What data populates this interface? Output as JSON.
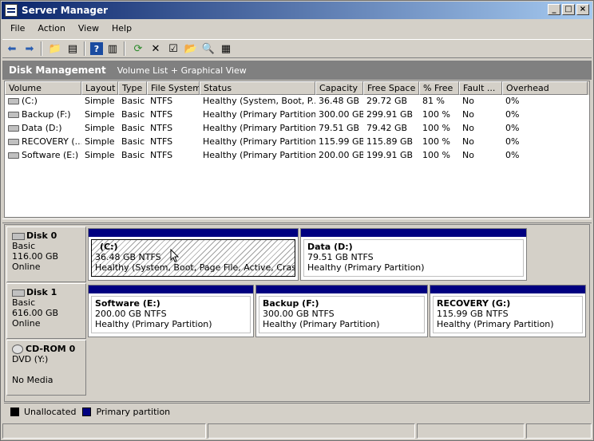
{
  "window": {
    "title": "Server Manager"
  },
  "menu": [
    "File",
    "Action",
    "View",
    "Help"
  ],
  "toolbar": [
    "back-icon",
    "forward-icon",
    "up-folder-icon",
    "show-hide-tree-icon",
    "help-icon",
    "properties-pane-icon",
    "refresh-icon",
    "delete-icon",
    "properties-icon",
    "open-icon",
    "search-icon",
    "export-icon"
  ],
  "header": {
    "title": "Disk Management",
    "view": "Volume List + Graphical View"
  },
  "columns": [
    "Volume",
    "Layout",
    "Type",
    "File System",
    "Status",
    "Capacity",
    "Free Space",
    "% Free",
    "Fault ...",
    "Overhead"
  ],
  "volumes": [
    [
      "(C:)",
      "Simple",
      "Basic",
      "NTFS",
      "Healthy (System, Boot, P...",
      "36.48 GB",
      "29.72 GB",
      "81 %",
      "No",
      "0%"
    ],
    [
      "Backup (F:)",
      "Simple",
      "Basic",
      "NTFS",
      "Healthy (Primary Partition)",
      "300.00 GB",
      "299.91 GB",
      "100 %",
      "No",
      "0%"
    ],
    [
      "Data (D:)",
      "Simple",
      "Basic",
      "NTFS",
      "Healthy (Primary Partition)",
      "79.51 GB",
      "79.42 GB",
      "100 %",
      "No",
      "0%"
    ],
    [
      "RECOVERY (...",
      "Simple",
      "Basic",
      "NTFS",
      "Healthy (Primary Partition)",
      "115.99 GB",
      "115.89 GB",
      "100 %",
      "No",
      "0%"
    ],
    [
      "Software (E:)",
      "Simple",
      "Basic",
      "NTFS",
      "Healthy (Primary Partition)",
      "200.00 GB",
      "199.91 GB",
      "100 %",
      "No",
      "0%"
    ]
  ],
  "disks": [
    {
      "name": "Disk 0",
      "type": "Basic",
      "size": "116.00 GB",
      "status": "Online",
      "partitions": [
        {
          "name": "(C:)",
          "size": "36.48 GB NTFS",
          "status": "Healthy (System, Boot, Page File, Active, Crash Dur"
        },
        {
          "name": "Data  (D:)",
          "size": "79.51 GB NTFS",
          "status": "Healthy (Primary Partition)"
        }
      ]
    },
    {
      "name": "Disk 1",
      "type": "Basic",
      "size": "616.00 GB",
      "status": "Online",
      "partitions": [
        {
          "name": "Software  (E:)",
          "size": "200.00 GB NTFS",
          "status": "Healthy (Primary Partition)"
        },
        {
          "name": "Backup  (F:)",
          "size": "300.00 GB NTFS",
          "status": "Healthy (Primary Partition)"
        },
        {
          "name": "RECOVERY  (G:)",
          "size": "115.99 GB NTFS",
          "status": "Healthy (Primary Partition)"
        }
      ]
    },
    {
      "name": "CD-ROM 0",
      "type": "DVD (Y:)",
      "size": "",
      "status": "No Media"
    }
  ],
  "legend": {
    "unallocated": "Unallocated",
    "primary": "Primary partition",
    "unallocated_color": "#000000",
    "primary_color": "#000080"
  }
}
